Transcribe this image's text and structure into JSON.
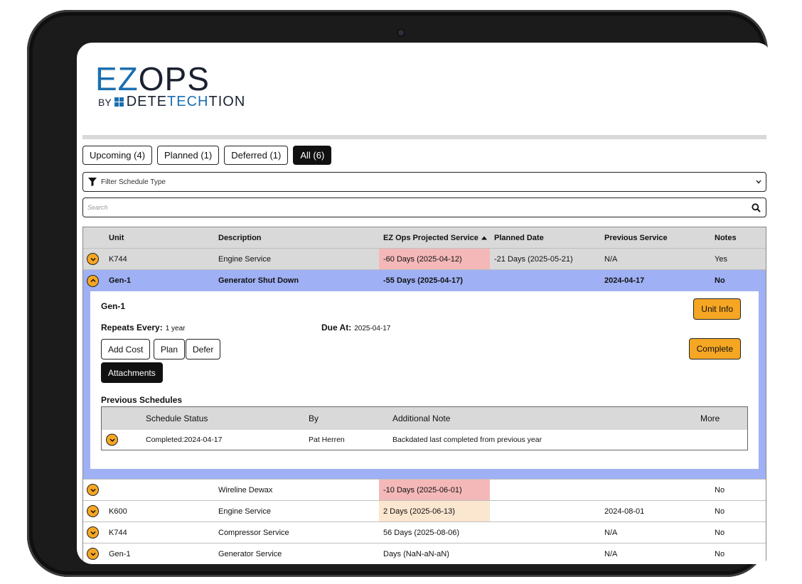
{
  "logo": {
    "ez": "EZ",
    "ops": "OPS",
    "by": "BY",
    "dete": "DETE",
    "tech": "TECH",
    "tion": "TION"
  },
  "tabs": [
    {
      "label": "Upcoming (4)",
      "active": false
    },
    {
      "label": "Planned (1)",
      "active": false
    },
    {
      "label": "Deferred (1)",
      "active": false
    },
    {
      "label": "All (6)",
      "active": true
    }
  ],
  "filter": {
    "placeholder": "Filter Schedule Type"
  },
  "search": {
    "placeholder": "Search"
  },
  "table": {
    "headers": {
      "unit": "Unit",
      "description": "Description",
      "projected": "EZ Ops Projected Service",
      "planned": "Planned Date",
      "previous": "Previous Service",
      "notes": "Notes"
    },
    "rows": [
      {
        "unit": "K744",
        "description": "Engine Service",
        "projected": "-60 Days (2025-04-12)",
        "planned": "-21 Days (2025-05-21)",
        "previous": "N/A",
        "notes": "Yes"
      },
      {
        "unit": "Gen-1",
        "description": "Generator Shut Down",
        "projected": "-55 Days (2025-04-17)",
        "planned": "",
        "previous": "2024-04-17",
        "notes": "No"
      },
      {
        "unit": "",
        "description": "Wireline Dewax",
        "projected": "-10 Days (2025-06-01)",
        "planned": "",
        "previous": "",
        "notes": "No"
      },
      {
        "unit": "K600",
        "description": "Engine Service",
        "projected": "2 Days (2025-06-13)",
        "planned": "",
        "previous": "2024-08-01",
        "notes": "No"
      },
      {
        "unit": "K744",
        "description": "Compressor Service",
        "projected": "56 Days (2025-08-06)",
        "planned": "",
        "previous": "N/A",
        "notes": "No"
      },
      {
        "unit": "Gen-1",
        "description": "Generator Service",
        "projected": "Days (NaN-aN-aN)",
        "planned": "",
        "previous": "N/A",
        "notes": "No"
      }
    ]
  },
  "detail": {
    "title": "Gen-1",
    "repeats_label": "Repeats Every:",
    "repeats_value": "1 year",
    "due_label": "Due At:",
    "due_value": "2025-04-17",
    "unit_info": "Unit Info",
    "add_cost": "Add Cost",
    "plan": "Plan",
    "defer": "Defer",
    "complete": "Complete",
    "attachments": "Attachments",
    "prev_title": "Previous Schedules",
    "sub_headers": {
      "status": "Schedule Status",
      "by": "By",
      "note": "Additional Note",
      "more": "More"
    },
    "sub_rows": [
      {
        "status": "Completed:2024-04-17",
        "by": "Pat Herren",
        "note": "Backdated last completed from previous year"
      }
    ]
  },
  "colors": {
    "accent_orange": "#f5a623",
    "selected_row": "#9fb0f4",
    "overdue": "#f4b8b8",
    "soon": "#fbe6cf",
    "brand_blue": "#1b6fb0"
  }
}
